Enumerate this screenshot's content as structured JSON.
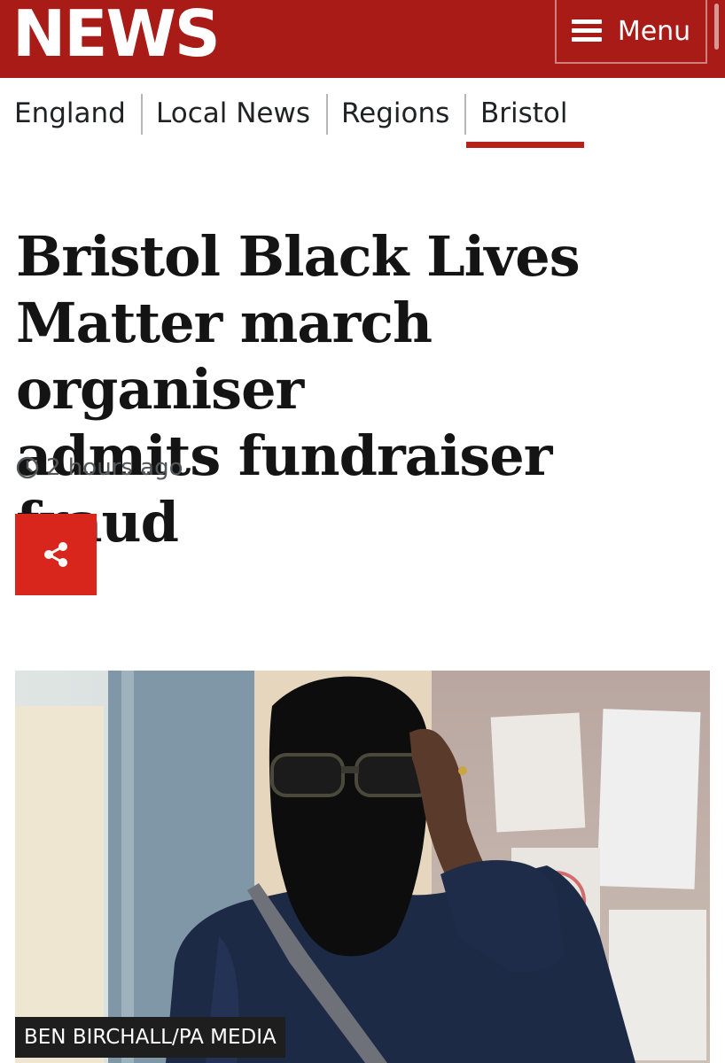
{
  "header": {
    "logo_text": "NEWS",
    "menu_label": "Menu",
    "brand_color": "#a91b16"
  },
  "breadcrumbs": [
    {
      "label": "England"
    },
    {
      "label": "Local News"
    },
    {
      "label": "Regions"
    },
    {
      "label": "Bristol",
      "active": true
    }
  ],
  "article": {
    "headline_lines": [
      "Bristol Black Lives",
      "Matter march organiser",
      "admits fundraiser fraud"
    ],
    "timestamp": "2 hours ago",
    "share_button_color": "#d9261c",
    "photo_caption": "BEN BIRCHALL/PA MEDIA"
  },
  "icons": {
    "menu": "hamburger-icon",
    "clock": "clock-icon",
    "share": "share-icon"
  }
}
